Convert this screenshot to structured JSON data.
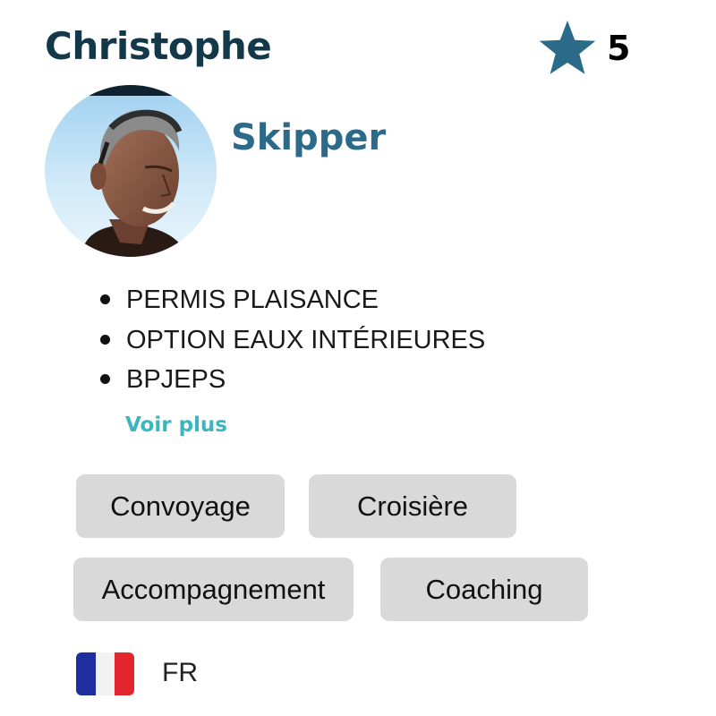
{
  "profile": {
    "name": "Christophe",
    "role": "Skipper",
    "avatar_icon": "skipper-portrait"
  },
  "rating": {
    "icon": "star-icon",
    "value": "5",
    "value_numeric": 5,
    "color": "#2b6a88"
  },
  "certifications": [
    "PERMIS PLAISANCE",
    "OPTION EAUX INTÉRIEURES",
    "BPJEPS"
  ],
  "more_link": {
    "label": "Voir plus",
    "color": "#3bb6be"
  },
  "services": [
    "Convoyage",
    "Croisière",
    "Accompagnement",
    "Coaching"
  ],
  "language": {
    "code": "FR",
    "flag_icon": "france-flag-icon",
    "flag_colors": [
      "#1e2e9e",
      "#f2f2f2",
      "#e3262e"
    ]
  },
  "colors": {
    "name_text": "#12384a",
    "role_text": "#2b6a88",
    "tag_background": "#d9d9d9"
  }
}
